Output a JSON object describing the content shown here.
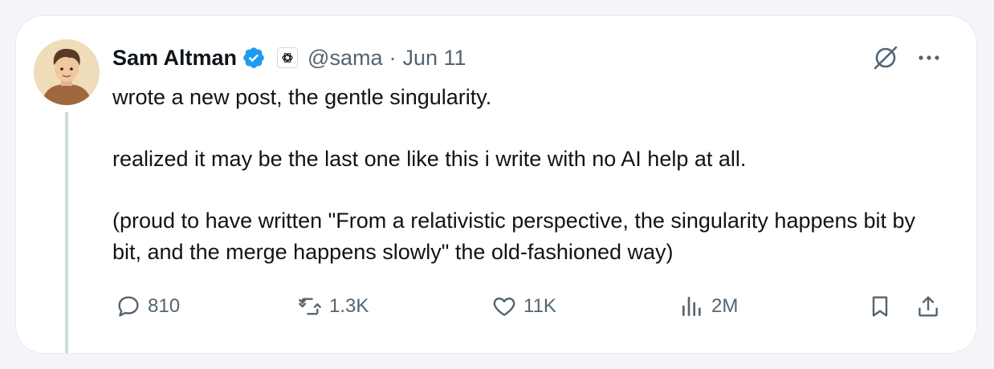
{
  "author": {
    "name": "Sam Altman",
    "handle": "@sama",
    "separator": "·",
    "date": "Jun 11"
  },
  "post": {
    "paragraphs": [
      "wrote a new post, the gentle singularity.",
      "realized it may be the last one like this i write with no AI help at all.",
      "(proud to have written \"From a relativistic perspective, the singularity happens bit by bit, and the merge happens slowly\" the old-fashioned way)"
    ]
  },
  "metrics": {
    "replies": "810",
    "reposts": "1.3K",
    "likes": "11K",
    "views": "2M"
  },
  "colors": {
    "text": "#0f1419",
    "muted": "#536471",
    "verified": "#1d9bf0"
  },
  "icons": [
    "verified-badge-icon",
    "openai-logo-icon",
    "grok-icon",
    "more-icon",
    "reply-icon",
    "repost-icon",
    "like-icon",
    "views-icon",
    "bookmark-icon",
    "share-icon"
  ]
}
